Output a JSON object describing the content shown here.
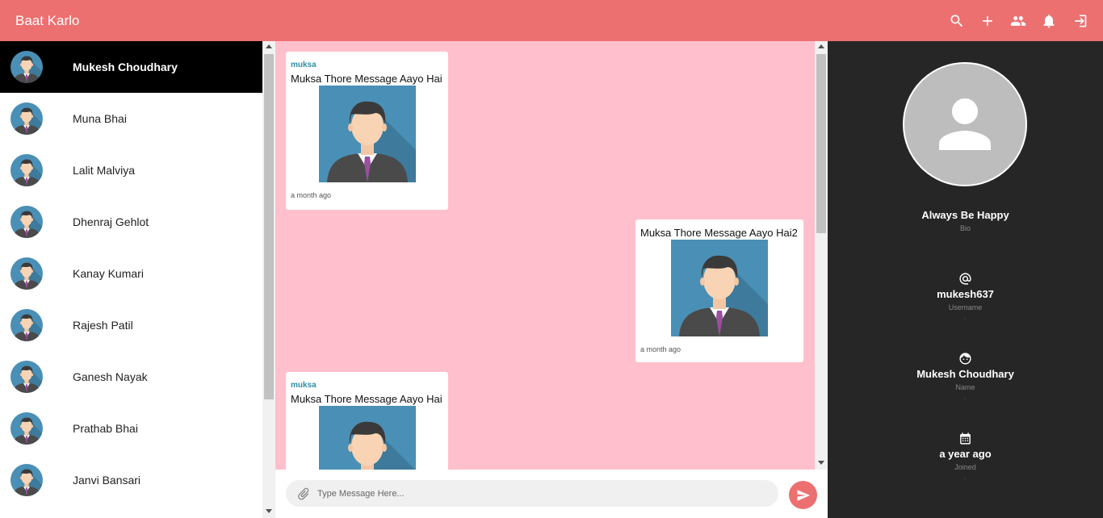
{
  "app": {
    "title": "Baat Karlo"
  },
  "topbar_icons": [
    "search-icon",
    "add-icon",
    "group-icon",
    "bell-icon",
    "logout-icon"
  ],
  "contacts": [
    {
      "name": "Mukesh Choudhary",
      "active": true
    },
    {
      "name": "Muna Bhai"
    },
    {
      "name": "Lalit Malviya"
    },
    {
      "name": "Dhenraj Gehlot"
    },
    {
      "name": "Kanay Kumari"
    },
    {
      "name": "Rajesh Patil"
    },
    {
      "name": "Ganesh Nayak"
    },
    {
      "name": "Prathab Bhai"
    },
    {
      "name": "Janvi Bansari"
    }
  ],
  "messages": [
    {
      "sender": "muksa",
      "text": "Muksa Thore Message Aayo Hai",
      "time": "a month ago",
      "side": "left"
    },
    {
      "sender": "",
      "text": "Muksa Thore Message Aayo Hai2",
      "time": "a month ago",
      "side": "right"
    },
    {
      "sender": "muksa",
      "text": "Muksa Thore Message Aayo Hai",
      "time": "",
      "side": "left"
    }
  ],
  "composer": {
    "placeholder": "Type Message Here..."
  },
  "profile": {
    "bio": {
      "value": "Always Be Happy",
      "label": "Bio"
    },
    "username": {
      "value": "mukesh637",
      "label": "Username"
    },
    "name": {
      "value": "Mukesh Choudhary",
      "label": "Name"
    },
    "joined": {
      "value": "a year ago",
      "label": "Joined"
    },
    "separator": "."
  },
  "colors": {
    "accent": "#ec7070",
    "chat_bg": "#ffbfcc",
    "profile_bg": "#262626",
    "sender": "#2f8ea8"
  }
}
